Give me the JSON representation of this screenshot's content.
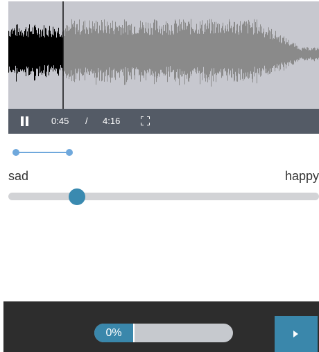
{
  "player": {
    "current_time": "0:45",
    "separator": "/",
    "total_time": "4:16",
    "played_fraction": 0.176,
    "icons": {
      "pause": "pause-icon",
      "fullscreen": "fullscreen-icon"
    },
    "colors": {
      "background": "#c7c8cf",
      "played_wave": "#000000",
      "unplayed_wave": "#8a8a8a",
      "control_bar": "#545b66"
    }
  },
  "range_indicator": {
    "start_fraction": 0.0,
    "end_fraction": 0.2,
    "color": "#6fa8dc"
  },
  "mood_slider": {
    "left_label": "sad",
    "right_label": "happy",
    "value_fraction": 0.22,
    "thumb_color": "#3a8ab0"
  },
  "footer": {
    "progress_text": "0%",
    "progress_fraction": 0.0,
    "next_icon": "play-next-icon",
    "accent_color": "#3a87ab"
  }
}
